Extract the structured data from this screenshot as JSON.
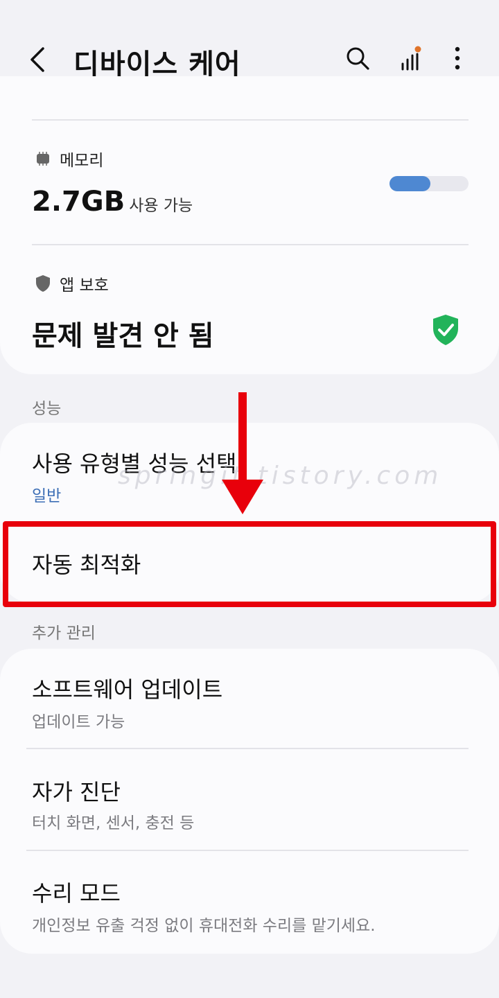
{
  "header": {
    "title": "디바이스 케어",
    "back_icon": "chevron-left-icon",
    "search_icon": "search-icon",
    "signal_icon": "signal-bars-icon",
    "more_icon": "more-vertical-icon"
  },
  "memory": {
    "label": "메모리",
    "value": "2.7GB",
    "unit": "사용 가능",
    "usage_fraction": 0.52,
    "meter_color": "#4e88d2"
  },
  "app_protection": {
    "label": "앱 보호",
    "status": "문제 발견 안 됨",
    "status_icon_color": "#22b35a"
  },
  "performance": {
    "section_title": "성능",
    "items": [
      {
        "title": "사용 유형별 성능 선택",
        "subtitle": "일반"
      },
      {
        "title": "자동 최적화"
      }
    ]
  },
  "additional": {
    "section_title": "추가 관리",
    "items": [
      {
        "title": "소프트웨어 업데이트",
        "subtitle": "업데이트 가능"
      },
      {
        "title": "자가 진단",
        "subtitle": "터치 화면, 센서, 충전 등"
      },
      {
        "title": "수리 모드",
        "subtitle": "개인정보 유출 걱정 없이 휴대전화 수리를 맡기세요."
      }
    ]
  },
  "watermark": "springit.tistory.com",
  "annotation": {
    "highlight_color": "#e8000b"
  }
}
